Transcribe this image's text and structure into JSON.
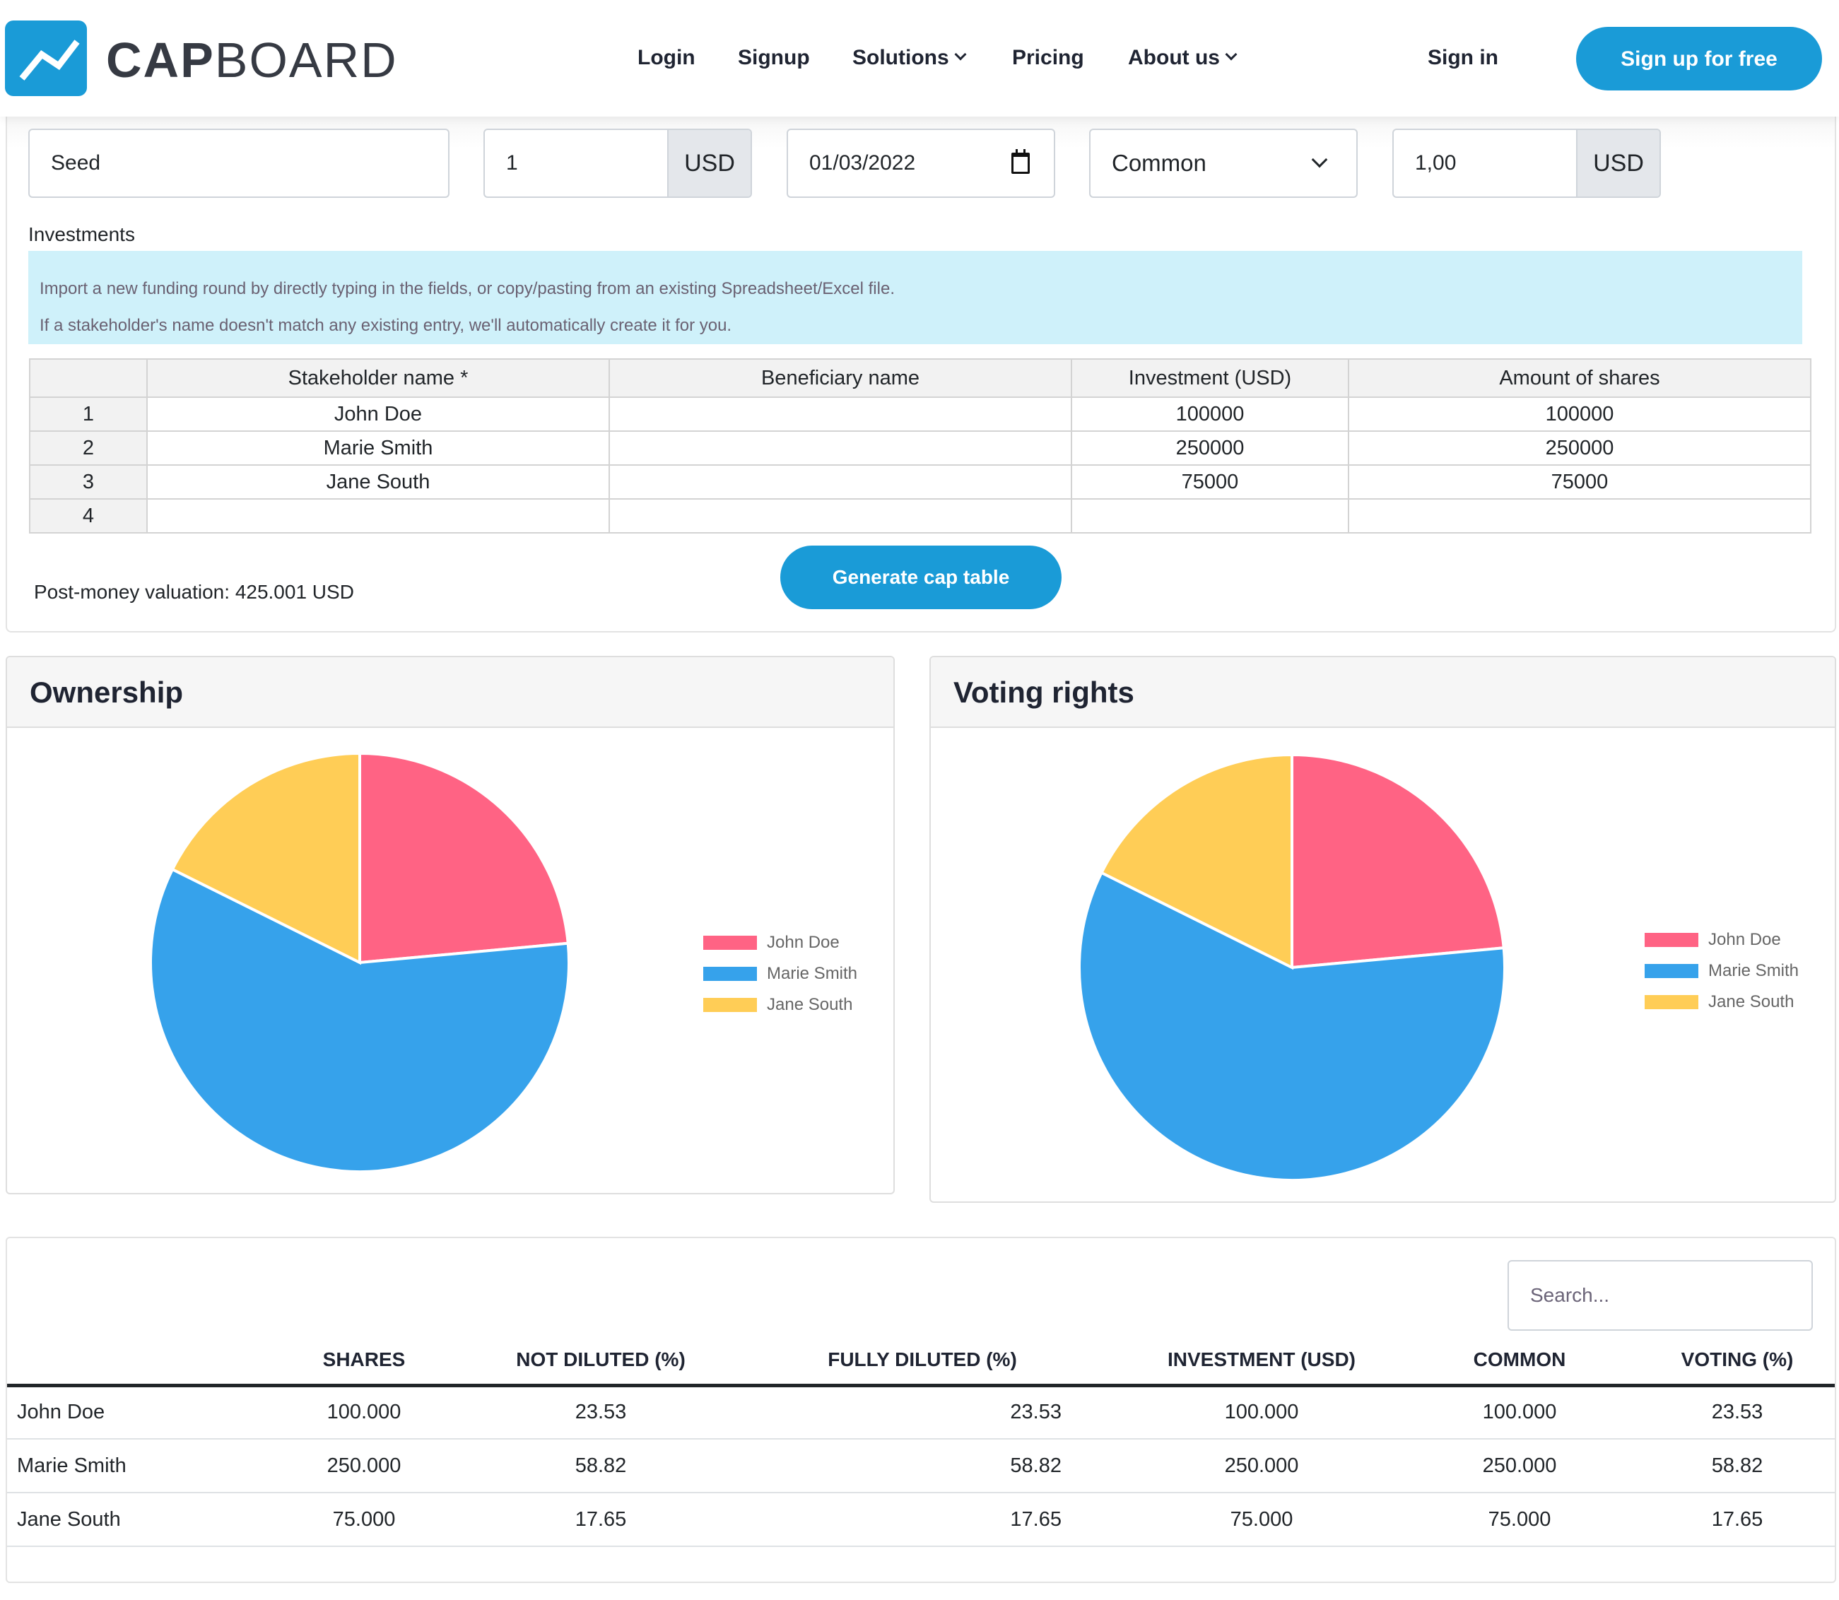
{
  "header": {
    "logo_text_bold": "CAP",
    "logo_text_light": "BOARD",
    "nav": [
      {
        "label": "Login",
        "has_dropdown": false
      },
      {
        "label": "Signup",
        "has_dropdown": false
      },
      {
        "label": "Solutions",
        "has_dropdown": true
      },
      {
        "label": "Pricing",
        "has_dropdown": false
      },
      {
        "label": "About us",
        "has_dropdown": true
      }
    ],
    "signin_label": "Sign in",
    "signup_label": "Sign up for free"
  },
  "round_form": {
    "round_name": "Seed",
    "price_per_share": "1",
    "price_currency": "USD",
    "date": "01/03/2022",
    "share_class": "Common",
    "nominal_value": "1,00",
    "nominal_currency": "USD"
  },
  "investments": {
    "label": "Investments",
    "info_lines": [
      "Import a new funding round by directly typing in the fields, or copy/pasting from an existing Spreadsheet/Excel file.",
      "If a stakeholder's name doesn't match any existing entry, we'll automatically create it for you."
    ],
    "columns": [
      "",
      "Stakeholder name *",
      "Beneficiary name",
      "Investment (USD)",
      "Amount of shares"
    ],
    "rows": [
      {
        "num": "1",
        "stakeholder": "John Doe",
        "beneficiary": "",
        "investment": "100000",
        "shares": "100000"
      },
      {
        "num": "2",
        "stakeholder": "Marie Smith",
        "beneficiary": "",
        "investment": "250000",
        "shares": "250000"
      },
      {
        "num": "3",
        "stakeholder": "Jane South",
        "beneficiary": "",
        "investment": "75000",
        "shares": "75000"
      },
      {
        "num": "4",
        "stakeholder": "",
        "beneficiary": "",
        "investment": "",
        "shares": ""
      }
    ],
    "post_money": "Post-money valuation: 425.001 USD",
    "generate_label": "Generate cap table"
  },
  "chart_data": [
    {
      "type": "pie",
      "title": "Ownership",
      "legend": "right",
      "categories": [
        "John Doe",
        "Marie Smith",
        "Jane South"
      ],
      "values": [
        23.53,
        58.82,
        17.65
      ],
      "colors": [
        "#ff6384",
        "#36a2eb",
        "#ffcd56"
      ]
    },
    {
      "type": "pie",
      "title": "Voting rights",
      "legend": "right",
      "categories": [
        "John Doe",
        "Marie Smith",
        "Jane South"
      ],
      "values": [
        23.53,
        58.82,
        17.65
      ],
      "colors": [
        "#ff6384",
        "#36a2eb",
        "#ffcd56"
      ]
    }
  ],
  "cap_table": {
    "search_placeholder": "Search...",
    "columns": [
      "",
      "SHARES",
      "NOT DILUTED (%)",
      "FULLY DILUTED (%)",
      "INVESTMENT (USD)",
      "COMMON",
      "VOTING (%)"
    ],
    "rows": [
      {
        "name": "John Doe",
        "shares": "100.000",
        "not_diluted": "23.53",
        "fully_diluted": "23.53",
        "investment": "100.000",
        "common": "100.000",
        "voting": "23.53"
      },
      {
        "name": "Marie Smith",
        "shares": "250.000",
        "not_diluted": "58.82",
        "fully_diluted": "58.82",
        "investment": "250.000",
        "common": "250.000",
        "voting": "58.82"
      },
      {
        "name": "Jane South",
        "shares": "75.000",
        "not_diluted": "17.65",
        "fully_diluted": "17.65",
        "investment": "75.000",
        "common": "75.000",
        "voting": "17.65"
      }
    ]
  },
  "colors": {
    "brand": "#1a9bd7",
    "info_bg": "#cff1fa"
  }
}
